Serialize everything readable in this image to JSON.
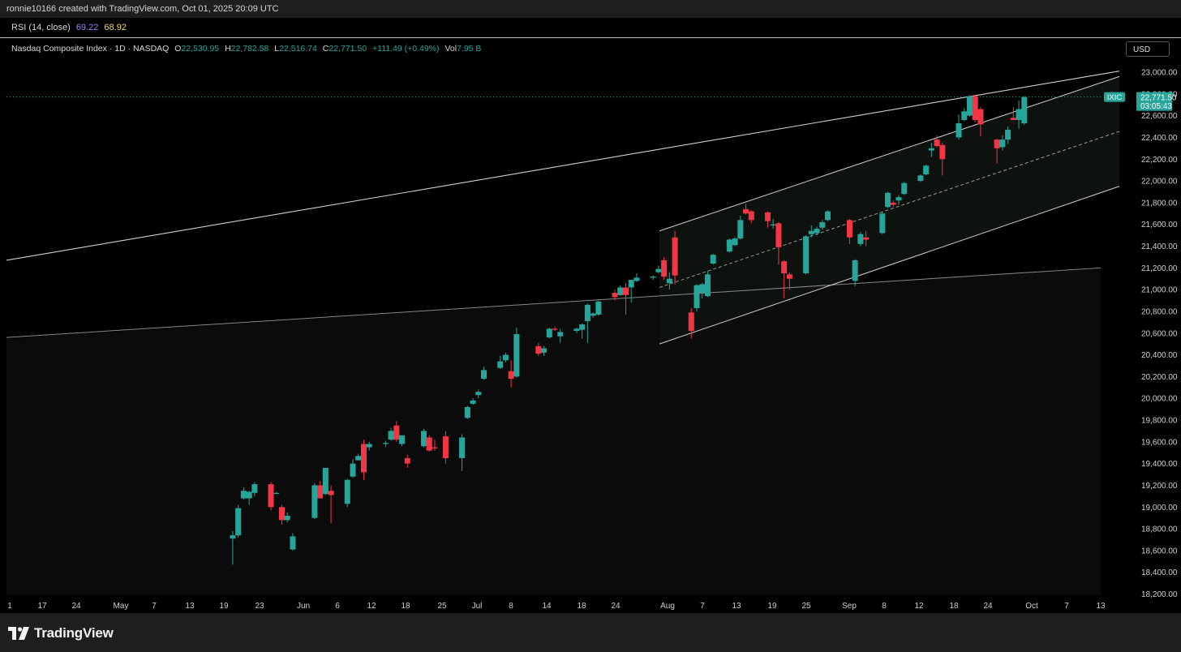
{
  "header": {
    "credit": "ronnie10166 created with TradingView.com, Oct 01, 2025 20:09 UTC"
  },
  "rsi": {
    "label": "RSI (14, close)",
    "value1": "69.22",
    "value2": "68.92",
    "color1": "#9c7df5",
    "color2": "#f5d76e"
  },
  "legend": {
    "symbol": "Nasdaq Composite Index · 1D · NASDAQ",
    "o_label": "O",
    "o_value": "22,530.95",
    "h_label": "H",
    "h_value": "22,782.58",
    "l_label": "L",
    "l_value": "22,516.74",
    "c_label": "C",
    "c_value": "22,771.50",
    "change": "+111.49 (+0.49%)",
    "vol_label": "Vol",
    "vol_value": "7.95 B"
  },
  "currency": "USD",
  "price_tag": {
    "ticker": "IXIC",
    "price": "22,771.50",
    "countdown": "03:05:43"
  },
  "footer": {
    "brand": "TradingView"
  },
  "colors": {
    "up": "#26a69a",
    "down": "#f23645",
    "line": "#cfcfcf"
  },
  "chart_data": {
    "type": "candlestick",
    "title": "Nasdaq Composite Index · 1D · NASDAQ",
    "ylim": [
      18200,
      23000
    ],
    "y_ticks": [
      "23,000.00",
      "22,800.00",
      "22,600.00",
      "22,400.00",
      "22,200.00",
      "22,000.00",
      "21,800.00",
      "21,600.00",
      "21,400.00",
      "21,200.00",
      "21,000.00",
      "20,800.00",
      "20,600.00",
      "20,400.00",
      "20,200.00",
      "20,000.00",
      "19,800.00",
      "19,600.00",
      "19,400.00",
      "19,200.00",
      "19,000.00",
      "18,800.00",
      "18,600.00",
      "18,400.00",
      "18,200.00"
    ],
    "x_ticks": [
      "1",
      "17",
      "24",
      "May",
      "7",
      "13",
      "19",
      "23",
      "Jun",
      "6",
      "12",
      "18",
      "25",
      "Jul",
      "8",
      "14",
      "18",
      "24",
      "Aug",
      "7",
      "13",
      "19",
      "25",
      "Sep",
      "8",
      "12",
      "18",
      "24",
      "Oct",
      "7",
      "13"
    ],
    "last_price": 22771.5,
    "candles": [
      {
        "date": "2025-05-12",
        "o": 18710,
        "h": 18780,
        "l": 18470,
        "c": 18740
      },
      {
        "date": "2025-05-13",
        "o": 18740,
        "h": 19020,
        "l": 18720,
        "c": 18990
      },
      {
        "date": "2025-05-14",
        "o": 19080,
        "h": 19180,
        "l": 19070,
        "c": 19150
      },
      {
        "date": "2025-05-15",
        "o": 19080,
        "h": 19150,
        "l": 19020,
        "c": 19140
      },
      {
        "date": "2025-05-16",
        "o": 19130,
        "h": 19230,
        "l": 19100,
        "c": 19210
      },
      {
        "date": "2025-05-19",
        "o": 19210,
        "h": 19230,
        "l": 18970,
        "c": 19000
      },
      {
        "date": "2025-05-20",
        "o": 19130,
        "h": 19140,
        "l": 19120,
        "c": 19130
      },
      {
        "date": "2025-05-21",
        "o": 19000,
        "h": 19020,
        "l": 18840,
        "c": 18880
      },
      {
        "date": "2025-05-22",
        "o": 18880,
        "h": 18950,
        "l": 18860,
        "c": 18920
      },
      {
        "date": "2025-05-23",
        "o": 18610,
        "h": 18760,
        "l": 18600,
        "c": 18730
      },
      {
        "date": "2025-05-27",
        "o": 18900,
        "h": 19220,
        "l": 18890,
        "c": 19200
      },
      {
        "date": "2025-05-28",
        "o": 19200,
        "h": 19240,
        "l": 19100,
        "c": 19080
      },
      {
        "date": "2025-05-29",
        "o": 19120,
        "h": 19360,
        "l": 19110,
        "c": 19360
      },
      {
        "date": "2025-05-30",
        "o": 19150,
        "h": 19200,
        "l": 18850,
        "c": 19110
      },
      {
        "date": "2025-06-02",
        "o": 19030,
        "h": 19260,
        "l": 19000,
        "c": 19250
      },
      {
        "date": "2025-06-03",
        "o": 19280,
        "h": 19440,
        "l": 19270,
        "c": 19400
      },
      {
        "date": "2025-06-04",
        "o": 19430,
        "h": 19490,
        "l": 19430,
        "c": 19470
      },
      {
        "date": "2025-06-05",
        "o": 19580,
        "h": 19620,
        "l": 19250,
        "c": 19320
      },
      {
        "date": "2025-06-06",
        "o": 19550,
        "h": 19600,
        "l": 19520,
        "c": 19580
      },
      {
        "date": "2025-06-09",
        "o": 19580,
        "h": 19610,
        "l": 19550,
        "c": 19590
      },
      {
        "date": "2025-06-10",
        "o": 19620,
        "h": 19730,
        "l": 19610,
        "c": 19700
      },
      {
        "date": "2025-06-11",
        "o": 19750,
        "h": 19790,
        "l": 19600,
        "c": 19620
      },
      {
        "date": "2025-06-12",
        "o": 19580,
        "h": 19660,
        "l": 19560,
        "c": 19660
      },
      {
        "date": "2025-06-13",
        "o": 19450,
        "h": 19480,
        "l": 19360,
        "c": 19400
      },
      {
        "date": "2025-06-16",
        "o": 19560,
        "h": 19720,
        "l": 19550,
        "c": 19700
      },
      {
        "date": "2025-06-17",
        "o": 19640,
        "h": 19660,
        "l": 19510,
        "c": 19520
      },
      {
        "date": "2025-06-18",
        "o": 19550,
        "h": 19620,
        "l": 19520,
        "c": 19540
      },
      {
        "date": "2025-06-20",
        "o": 19650,
        "h": 19700,
        "l": 19400,
        "c": 19450
      },
      {
        "date": "2025-06-23",
        "o": 19450,
        "h": 19670,
        "l": 19330,
        "c": 19640
      },
      {
        "date": "2025-06-24",
        "o": 19820,
        "h": 19930,
        "l": 19810,
        "c": 19920
      },
      {
        "date": "2025-06-25",
        "o": 19950,
        "h": 20000,
        "l": 19940,
        "c": 19980
      },
      {
        "date": "2025-06-26",
        "o": 20030,
        "h": 20080,
        "l": 20000,
        "c": 20060
      },
      {
        "date": "2025-06-27",
        "o": 20180,
        "h": 20290,
        "l": 20170,
        "c": 20260
      },
      {
        "date": "2025-06-30",
        "o": 20280,
        "h": 20390,
        "l": 20270,
        "c": 20340
      },
      {
        "date": "2025-07-01",
        "o": 20350,
        "h": 20420,
        "l": 20330,
        "c": 20400
      },
      {
        "date": "2025-07-02",
        "o": 20250,
        "h": 20350,
        "l": 20100,
        "c": 20180
      },
      {
        "date": "2025-07-03",
        "o": 20200,
        "h": 20650,
        "l": 20190,
        "c": 20590
      },
      {
        "date": "2025-07-07",
        "o": 20480,
        "h": 20510,
        "l": 20390,
        "c": 20410
      },
      {
        "date": "2025-07-08",
        "o": 20420,
        "h": 20480,
        "l": 20390,
        "c": 20460
      },
      {
        "date": "2025-07-09",
        "o": 20560,
        "h": 20650,
        "l": 20550,
        "c": 20640
      },
      {
        "date": "2025-07-10",
        "o": 20640,
        "h": 20660,
        "l": 20620,
        "c": 20630
      },
      {
        "date": "2025-07-11",
        "o": 20570,
        "h": 20640,
        "l": 20510,
        "c": 20610
      },
      {
        "date": "2025-07-14",
        "o": 20620,
        "h": 20650,
        "l": 20600,
        "c": 20640
      },
      {
        "date": "2025-07-15",
        "o": 20630,
        "h": 20690,
        "l": 20550,
        "c": 20680
      },
      {
        "date": "2025-07-16",
        "o": 20710,
        "h": 20870,
        "l": 20510,
        "c": 20860
      },
      {
        "date": "2025-07-17",
        "o": 20760,
        "h": 20790,
        "l": 20740,
        "c": 20780
      },
      {
        "date": "2025-07-18",
        "o": 20770,
        "h": 20900,
        "l": 20760,
        "c": 20890
      },
      {
        "date": "2025-07-21",
        "o": 20970,
        "h": 21000,
        "l": 20900,
        "c": 20930
      },
      {
        "date": "2025-07-22",
        "o": 20950,
        "h": 21040,
        "l": 20940,
        "c": 21020
      },
      {
        "date": "2025-07-23",
        "o": 21020,
        "h": 21060,
        "l": 20770,
        "c": 20950
      },
      {
        "date": "2025-07-24",
        "o": 21020,
        "h": 21080,
        "l": 20880,
        "c": 21090
      },
      {
        "date": "2025-07-25",
        "o": 21080,
        "h": 21150,
        "l": 21070,
        "c": 21110
      },
      {
        "date": "2025-07-28",
        "o": 21110,
        "h": 21130,
        "l": 21090,
        "c": 21120
      },
      {
        "date": "2025-07-29",
        "o": 21160,
        "h": 21220,
        "l": 21150,
        "c": 21190
      },
      {
        "date": "2025-07-30",
        "o": 21270,
        "h": 21300,
        "l": 21090,
        "c": 21120
      },
      {
        "date": "2025-07-31",
        "o": 21060,
        "h": 21160,
        "l": 21000,
        "c": 21100
      },
      {
        "date": "2025-08-01",
        "o": 21480,
        "h": 21540,
        "l": 21050,
        "c": 21130
      },
      {
        "date": "2025-08-04",
        "o": 20790,
        "h": 20830,
        "l": 20550,
        "c": 20620
      },
      {
        "date": "2025-08-05",
        "o": 20830,
        "h": 21050,
        "l": 20800,
        "c": 21040
      },
      {
        "date": "2025-08-06",
        "o": 20970,
        "h": 21060,
        "l": 20920,
        "c": 21050
      },
      {
        "date": "2025-08-07",
        "o": 20940,
        "h": 21170,
        "l": 20930,
        "c": 21140
      },
      {
        "date": "2025-08-08",
        "o": 21240,
        "h": 21330,
        "l": 21230,
        "c": 21320
      },
      {
        "date": "2025-08-11",
        "o": 21350,
        "h": 21470,
        "l": 21340,
        "c": 21460
      },
      {
        "date": "2025-08-12",
        "o": 21410,
        "h": 21480,
        "l": 21400,
        "c": 21470
      },
      {
        "date": "2025-08-13",
        "o": 21470,
        "h": 21680,
        "l": 21460,
        "c": 21640
      },
      {
        "date": "2025-08-14",
        "o": 21740,
        "h": 21790,
        "l": 21690,
        "c": 21700
      },
      {
        "date": "2025-08-15",
        "o": 21720,
        "h": 21730,
        "l": 21610,
        "c": 21640
      },
      {
        "date": "2025-08-18",
        "o": 21710,
        "h": 21720,
        "l": 21570,
        "c": 21630
      },
      {
        "date": "2025-08-19",
        "o": 21590,
        "h": 21650,
        "l": 21560,
        "c": 21600
      },
      {
        "date": "2025-08-20",
        "o": 21610,
        "h": 21620,
        "l": 21230,
        "c": 21390
      },
      {
        "date": "2025-08-21",
        "o": 21260,
        "h": 21270,
        "l": 20920,
        "c": 21150
      },
      {
        "date": "2025-08-22",
        "o": 21140,
        "h": 21160,
        "l": 21000,
        "c": 21100
      },
      {
        "date": "2025-08-25",
        "o": 21150,
        "h": 21500,
        "l": 21140,
        "c": 21490
      },
      {
        "date": "2025-08-26",
        "o": 21510,
        "h": 21590,
        "l": 21480,
        "c": 21540
      },
      {
        "date": "2025-08-27",
        "o": 21520,
        "h": 21580,
        "l": 21500,
        "c": 21560
      },
      {
        "date": "2025-08-28",
        "o": 21570,
        "h": 21640,
        "l": 21550,
        "c": 21620
      },
      {
        "date": "2025-08-29",
        "o": 21640,
        "h": 21730,
        "l": 21630,
        "c": 21720
      },
      {
        "date": "2025-09-02",
        "o": 21640,
        "h": 21650,
        "l": 21420,
        "c": 21480
      },
      {
        "date": "2025-09-03",
        "o": 21080,
        "h": 21280,
        "l": 21030,
        "c": 21270
      },
      {
        "date": "2025-09-04",
        "o": 21420,
        "h": 21530,
        "l": 21400,
        "c": 21510
      },
      {
        "date": "2025-09-05",
        "o": 21480,
        "h": 21540,
        "l": 21400,
        "c": 21460
      },
      {
        "date": "2025-09-08",
        "o": 21520,
        "h": 21710,
        "l": 21510,
        "c": 21700
      },
      {
        "date": "2025-09-09",
        "o": 21760,
        "h": 21900,
        "l": 21750,
        "c": 21890
      },
      {
        "date": "2025-09-10",
        "o": 21800,
        "h": 21820,
        "l": 21760,
        "c": 21780
      },
      {
        "date": "2025-09-11",
        "o": 21820,
        "h": 21870,
        "l": 21780,
        "c": 21850
      },
      {
        "date": "2025-09-12",
        "o": 21880,
        "h": 21990,
        "l": 21870,
        "c": 21980
      },
      {
        "date": "2025-09-15",
        "o": 22000,
        "h": 22060,
        "l": 21990,
        "c": 22050
      },
      {
        "date": "2025-09-16",
        "o": 22060,
        "h": 22150,
        "l": 22050,
        "c": 22140
      },
      {
        "date": "2025-09-17",
        "o": 22280,
        "h": 22350,
        "l": 22220,
        "c": 22300
      },
      {
        "date": "2025-09-18",
        "o": 22380,
        "h": 22420,
        "l": 22310,
        "c": 22320
      },
      {
        "date": "2025-09-19",
        "o": 22330,
        "h": 22350,
        "l": 22050,
        "c": 22200
      },
      {
        "date": "2025-09-22",
        "o": 22400,
        "h": 22610,
        "l": 22380,
        "c": 22530
      },
      {
        "date": "2025-09-23",
        "o": 22560,
        "h": 22670,
        "l": 22550,
        "c": 22640
      },
      {
        "date": "2025-09-24",
        "o": 22600,
        "h": 22790,
        "l": 22590,
        "c": 22780
      },
      {
        "date": "2025-09-25",
        "o": 22780,
        "h": 22790,
        "l": 22540,
        "c": 22560
      },
      {
        "date": "2025-09-26",
        "o": 22660,
        "h": 22680,
        "l": 22410,
        "c": 22520
      },
      {
        "date": "2025-09-29",
        "o": 22380,
        "h": 22390,
        "l": 22160,
        "c": 22300
      },
      {
        "date": "2025-09-30",
        "o": 22310,
        "h": 22420,
        "l": 22280,
        "c": 22380
      },
      {
        "date": "2025-10-01",
        "o": 22380,
        "h": 22500,
        "l": 22340,
        "c": 22470
      },
      {
        "date": "2025-10-02",
        "o": 22580,
        "h": 22680,
        "l": 22560,
        "c": 22560
      },
      {
        "date": "2025-10-03",
        "o": 22560,
        "h": 22740,
        "l": 22480,
        "c": 22660
      },
      {
        "date": "2025-10-04",
        "o": 22530,
        "h": 22782,
        "l": 22516,
        "c": 22771
      }
    ]
  }
}
